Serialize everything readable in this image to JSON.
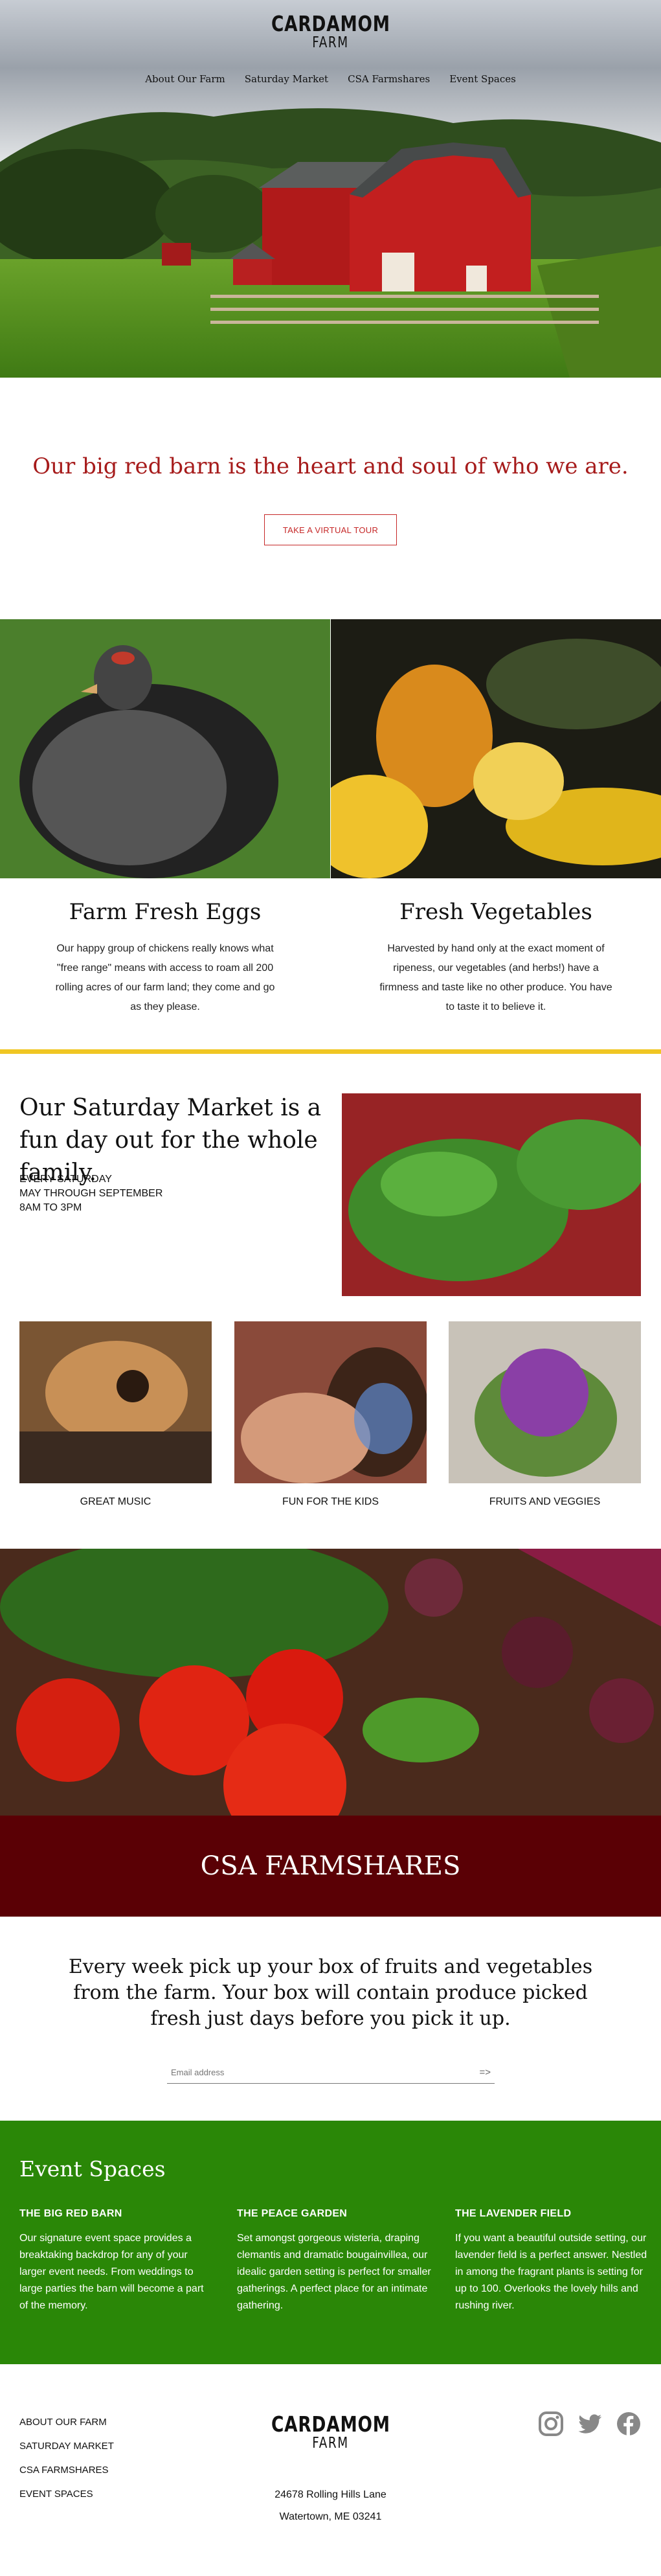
{
  "brand": {
    "line1": "CARDAMOM",
    "line2": "FARM"
  },
  "nav": {
    "items": [
      "About Our Farm",
      "Saturday Market",
      "CSA Farmshares",
      "Event Spaces"
    ]
  },
  "intro": {
    "tagline": "Our big red barn is the heart and soul of who we are.",
    "button": "TAKE A VIRTUAL TOUR"
  },
  "features": [
    {
      "title": "Farm Fresh Eggs",
      "text": "Our happy group of chickens really knows what \"free range\" means with access to roam all 200 rolling acres of our farm land; they come and go as they please."
    },
    {
      "title": "Fresh Vegetables",
      "text": "Harvested by hand only at the exact moment of ripeness, our vegetables (and herbs!) have a firmness and taste like no other produce. You have to taste it to believe it."
    }
  ],
  "market": {
    "heading": "Our Saturday Market is a fun day out for the whole family.",
    "schedule": [
      "EVERY SATURDAY",
      "MAY THROUGH SEPTEMBER",
      "8AM TO 3PM"
    ],
    "captions": [
      "GREAT MUSIC",
      "FUN FOR THE KIDS",
      "FRUITS AND VEGGIES"
    ]
  },
  "csa": {
    "title": "CSA FARMSHARES",
    "text": "Every week pick up your box of fruits and vegetables from the farm. Your box will contain produce picked fresh just days before you pick it up.",
    "email_placeholder": "Email address",
    "submit": "=>"
  },
  "events": {
    "title": "Event Spaces",
    "items": [
      {
        "title": "THE BIG RED BARN",
        "text": "Our signature event space provides a breaktaking backdrop for any of your larger event needs. From weddings to large parties the barn will become a part of the memory."
      },
      {
        "title": "THE PEACE GARDEN",
        "text": "Set amongst gorgeous wisteria, draping clemantis and dramatic bougainvillea, our idealic garden setting is perfect for smaller gatherings. A perfect place for an intimate gathering."
      },
      {
        "title": "THE LAVENDER FIELD",
        "text": "If you want a beautiful outside setting, our lavender field is a perfect answer. Nestled in among the fragrant plants is setting for up to 100. Overlooks the lovely hills and rushing river."
      }
    ]
  },
  "footer": {
    "links": [
      "ABOUT OUR FARM",
      "SATURDAY MARKET",
      "CSA FARMSHARES",
      "EVENT SPACES"
    ],
    "address": [
      "24678 Rolling Hills Lane",
      "Watertown, ME 03241"
    ],
    "social": [
      "instagram-icon",
      "twitter-icon",
      "facebook-icon"
    ]
  },
  "colors": {
    "accent_red": "#a61b1b",
    "maroon": "#5a0005",
    "green": "#2a8707",
    "gold": "#f0c623"
  }
}
